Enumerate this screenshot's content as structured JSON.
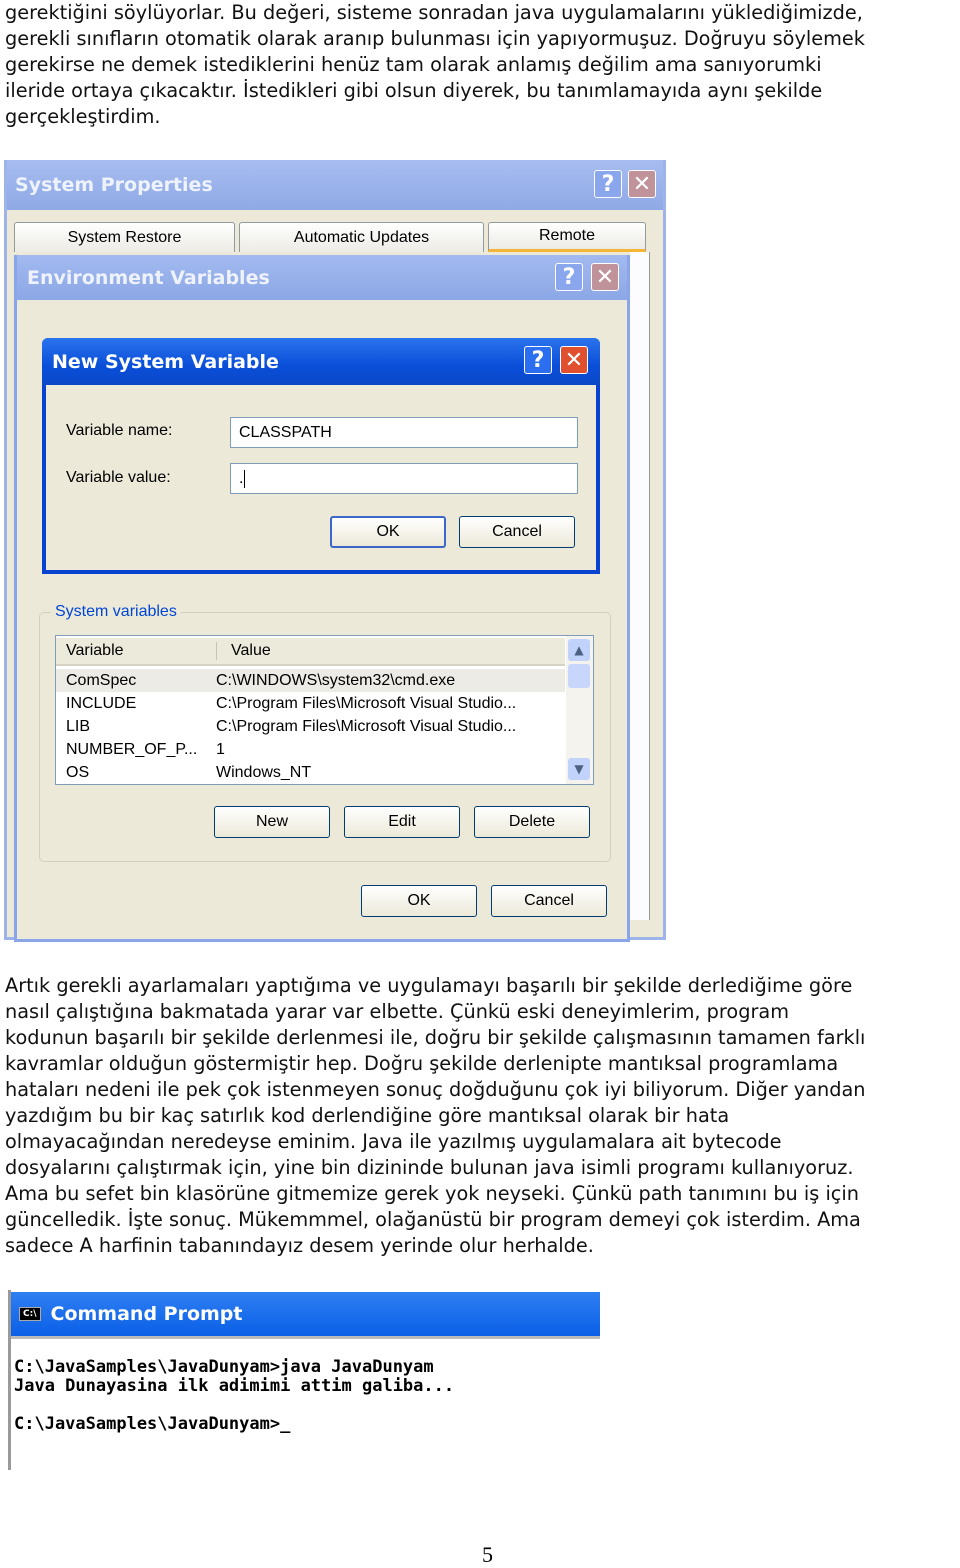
{
  "paragraph1": [
    "gerektiğini söylüyorlar. Bu değeri, sisteme sonradan java uygulamalarını yüklediğimizde,",
    "gerekli sınıfların otomatik olarak aranıp bulunması için yapıyormuşuz. Doğruyu söylemek",
    "gerekirse ne demek istediklerini henüz tam olarak anlamış değilim ama sanıyorumki",
    "ileride ortaya çıkacaktır. İstedikleri gibi olsun diyerek, bu tanımlamayıda aynı şekilde",
    "gerçekleştirdim."
  ],
  "system_properties": {
    "title": "System Properties",
    "tabs": [
      "System Restore",
      "Automatic Updates",
      "Remote"
    ]
  },
  "environment_variables": {
    "title": "Environment Variables",
    "group_label": "System variables",
    "columns": [
      "Variable",
      "Value"
    ],
    "rows": [
      [
        "ComSpec",
        "C:\\WINDOWS\\system32\\cmd.exe"
      ],
      [
        "INCLUDE",
        "C:\\Program Files\\Microsoft Visual Studio..."
      ],
      [
        "LIB",
        "C:\\Program Files\\Microsoft Visual Studio..."
      ],
      [
        "NUMBER_OF_P...",
        "1"
      ],
      [
        "OS",
        "Windows_NT"
      ]
    ],
    "new": "New",
    "edit": "Edit",
    "delete": "Delete",
    "ok": "OK",
    "cancel": "Cancel"
  },
  "new_system_variable": {
    "title": "New System Variable",
    "name_label": "Variable name:",
    "name_value": "CLASSPATH",
    "value_label": "Variable value:",
    "value_value": ".",
    "ok": "OK",
    "cancel": "Cancel"
  },
  "paragraph2": [
    "Artık gerekli ayarlamaları yaptığıma ve uygulamayı başarılı bir şekilde derlediğime göre",
    "nasıl çalıştığına bakmatada yarar var elbette. Çünkü eski deneyimlerim, program",
    "kodunun başarılı bir şekilde derlenmesi ile, doğru bir şekilde çalışmasının tamamen farklı",
    "kavramlar olduğun göstermiştir hep. Doğru şekilde derlenipte mantıksal programlama",
    "hataları nedeni ile pek çok istenmeyen sonuç doğduğunu çok iyi biliyorum. Diğer yandan",
    "yazdığım bu bir kaç satırlık kod derlendiğine göre mantıksal olarak bir hata",
    "olmayacağından neredeyse eminim. Java ile yazılmış uygulamalara ait bytecode",
    "dosyalarını çalıştırmak için, yine bin dizininde bulunan java isimli programı kullanıyoruz.",
    "Ama bu sefet bin klasörüne gitmemize gerek yok neyseki. Çünkü path tanımını bu iş için",
    "güncelledik. İşte sonuç. Mükemmmel, olağanüstü bir program demeyi çok isterdim. Ama",
    "sadece A harfinin tabanındayız desem yerinde olur herhalde."
  ],
  "command_prompt": {
    "title": "Command Prompt",
    "icon_text": "C:\\",
    "lines": [
      "C:\\JavaSamples\\JavaDunyam>java JavaDunyam",
      "Java Dunayasina ilk adimimi attim galiba...",
      "C:\\JavaSamples\\JavaDunyam>_"
    ]
  },
  "page_number": "5"
}
